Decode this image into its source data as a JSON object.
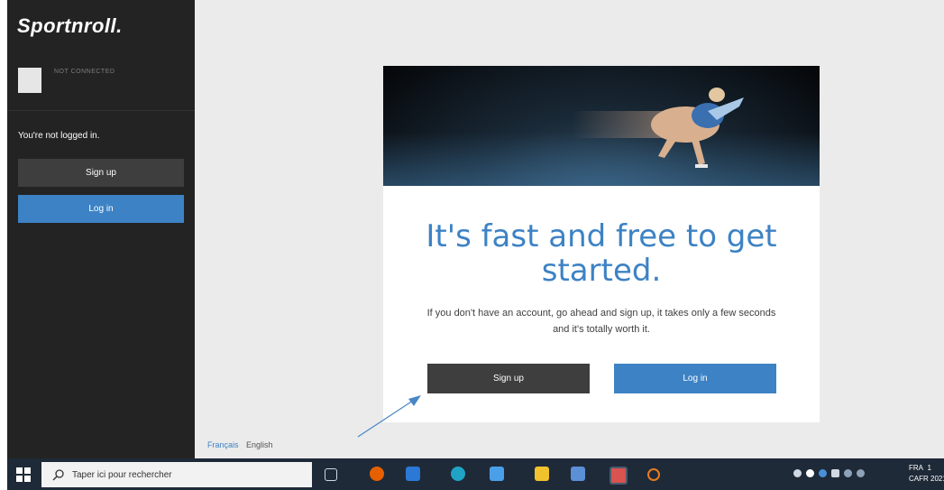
{
  "sidebar": {
    "logo": "Sportnroll.",
    "connection_status": "NOT CONNECTED",
    "not_logged_text": "You're not logged in.",
    "signup_label": "Sign up",
    "login_label": "Log in"
  },
  "card": {
    "headline": "It's fast and free to get started.",
    "subtext": "If you don't have an account, go ahead and sign up, it takes only a few seconds and it's totally worth it.",
    "signup_label": "Sign up",
    "login_label": "Log in"
  },
  "languages": [
    "Français",
    "English"
  ],
  "taskbar": {
    "search_placeholder": "Taper ici pour rechercher",
    "tray_lang": "FRA",
    "tray_region": "CAFR",
    "clock_time": "1",
    "clock_date": "2021"
  },
  "colors": {
    "accent": "#3d82c4",
    "sidebar_bg": "#232323",
    "dark_button": "#3e3e3e",
    "taskbar_bg": "#1f2a38"
  }
}
